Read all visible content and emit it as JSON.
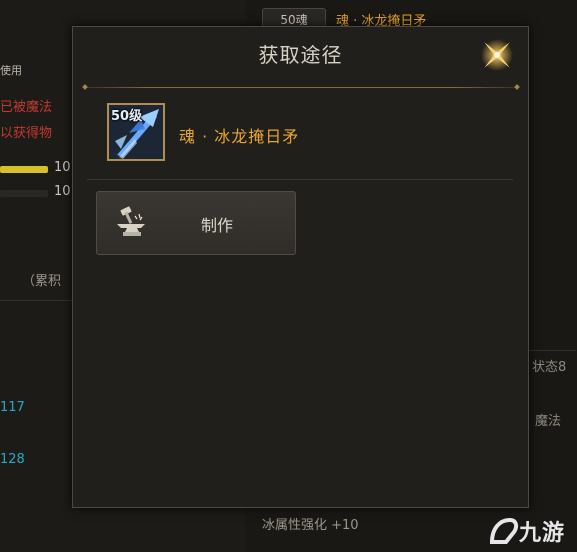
{
  "background": {
    "left_panel": {
      "label_top": "使用",
      "warning_line1": "已被魔法",
      "warning_line2": "以获得物",
      "bar1_value": "10",
      "bar2_value": "10",
      "hint": "（累积",
      "stat1": "117",
      "stat2": "128"
    },
    "right_panel": {
      "item_tag": "50魂",
      "item_title": "魂 · 冰龙掩日矛",
      "side_text1": "状态8",
      "side_text2": "。魔法",
      "bottom_stat": "冰属性强化 +10"
    },
    "colors": {
      "warning": "#c23a2e",
      "bar": "#d7c12a",
      "stat": "#28a7c4"
    }
  },
  "modal": {
    "title": "获取途径",
    "close_icon": "close-star-icon",
    "item": {
      "level_label": "50级",
      "name": "魂 · 冰龙掩日矛",
      "icon": "ice-spear-icon",
      "name_color": "#e8a52e"
    },
    "sources": [
      {
        "label": "制作",
        "icon": "anvil-hammer-icon"
      }
    ]
  },
  "watermark": {
    "text": "九游"
  }
}
